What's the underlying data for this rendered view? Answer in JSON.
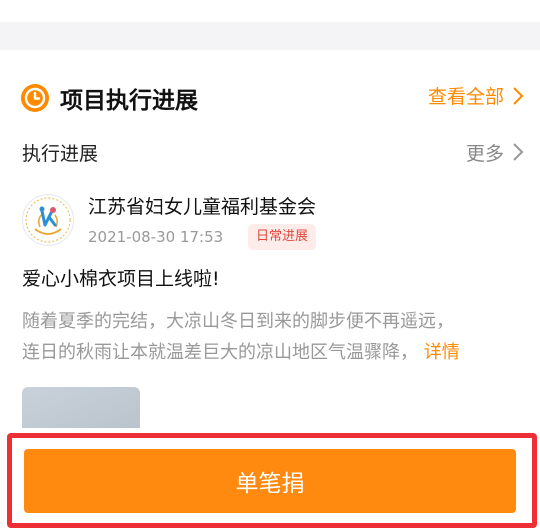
{
  "section": {
    "title": "项目执行进展",
    "view_all": "查看全部"
  },
  "progress": {
    "label": "执行进展",
    "more": "更多"
  },
  "post": {
    "org_name": "江苏省妇女儿童福利基金会",
    "date": "2021-08-30 17:53",
    "tag": "日常进展",
    "title": "爱心小棉衣项目上线啦!",
    "body_line1": "随着夏季的完结，大凉山冬日到来的脚步便不再遥远，",
    "body_line2": "连日的秋雨让本就温差巨大的凉山地区气温骤降，",
    "detail": "详情"
  },
  "bottom": {
    "donate_label": "单笔捐"
  },
  "colors": {
    "accent": "#ff8a00",
    "tag_bg": "#fdecea",
    "tag_text": "#e0483d",
    "highlight": "#ee2f36"
  }
}
